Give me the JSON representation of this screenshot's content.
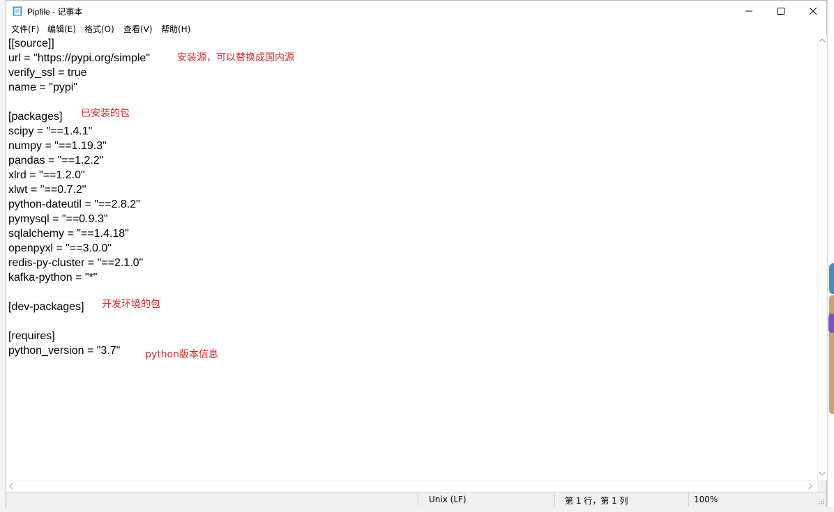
{
  "window": {
    "title": "Pipfile - 记事本"
  },
  "menu": [
    "文件(F)",
    "编辑(E)",
    "格式(O)",
    "查看(V)",
    "帮助(H)"
  ],
  "editor": {
    "lines": [
      "[[source]]",
      "url = \"https://pypi.org/simple\"",
      "verify_ssl = true",
      "name = \"pypi\"",
      "",
      "[packages]",
      "scipy = \"==1.4.1\"",
      "numpy = \"==1.19.3\"",
      "pandas = \"==1.2.2\"",
      "xlrd = \"==1.2.0\"",
      "xlwt = \"==0.7.2\"",
      "python-dateutil = \"==2.8.2\"",
      "pymysql = \"==0.9.3\"",
      "sqlalchemy = \"==1.4.18\"",
      "openpyxl = \"==3.0.0\"",
      "redis-py-cluster = \"==2.1.0\"",
      "kafka-python = \"*\"",
      "",
      "[dev-packages]",
      "",
      "[requires]",
      "python_version = \"3.7\""
    ],
    "annotations": {
      "source": "安装源，可以替换成国内源",
      "packages": "已安装的包",
      "dev_packages": "开发环境的包",
      "requires": "python版本信息"
    }
  },
  "status": {
    "line_ending": "Unix (LF)",
    "position": "第 1 行，第 1 列",
    "zoom": "100%"
  },
  "colors": {
    "annotation": "#e02424",
    "statusbar": "#f0f0f0"
  }
}
